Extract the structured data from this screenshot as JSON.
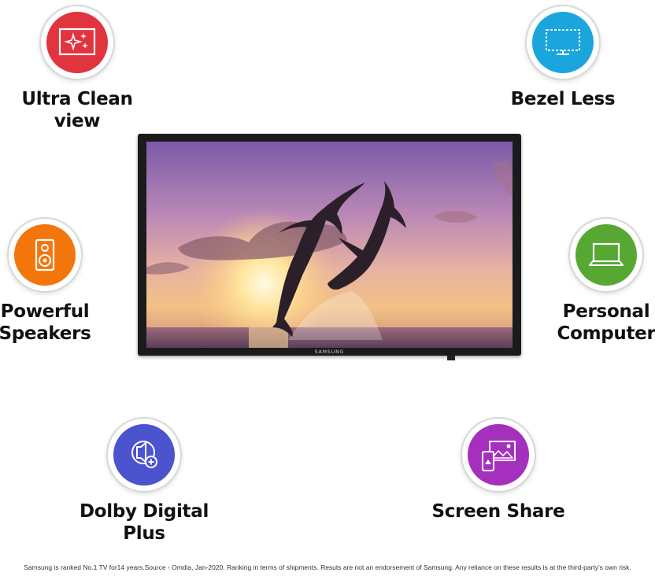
{
  "features": {
    "ultra_clean": {
      "line1": "Ultra Clean",
      "line2": "view",
      "icon": "sparkle-screen-icon",
      "color": "#e0343f"
    },
    "bezel_less": {
      "line1": "Bezel Less",
      "icon": "bezel-monitor-icon",
      "color": "#1aa6dc"
    },
    "speakers": {
      "line1": "Powerful",
      "line2": "Speakers",
      "icon": "speaker-icon",
      "color": "#f2760c"
    },
    "personal_computer": {
      "line1": "Personal",
      "line2": "Computer",
      "icon": "laptop-icon",
      "color": "#56a832"
    },
    "dolby": {
      "line1": "Dolby Digital",
      "line2": "Plus",
      "icon": "sound-plus-icon",
      "color": "#4b53cf"
    },
    "screen_share": {
      "line1": "Screen Share",
      "icon": "screen-share-icon",
      "color": "#a530be"
    }
  },
  "tv": {
    "brand": "SAMSUNG"
  },
  "disclaimer": "Samsung is ranked No.1 TV for14 years.Source - Omdia, Jan-2020. Ranking in terms of shipments. Resuts are not an endorsement of Samsung. Any reliance on these results is at the third-party's own risk."
}
